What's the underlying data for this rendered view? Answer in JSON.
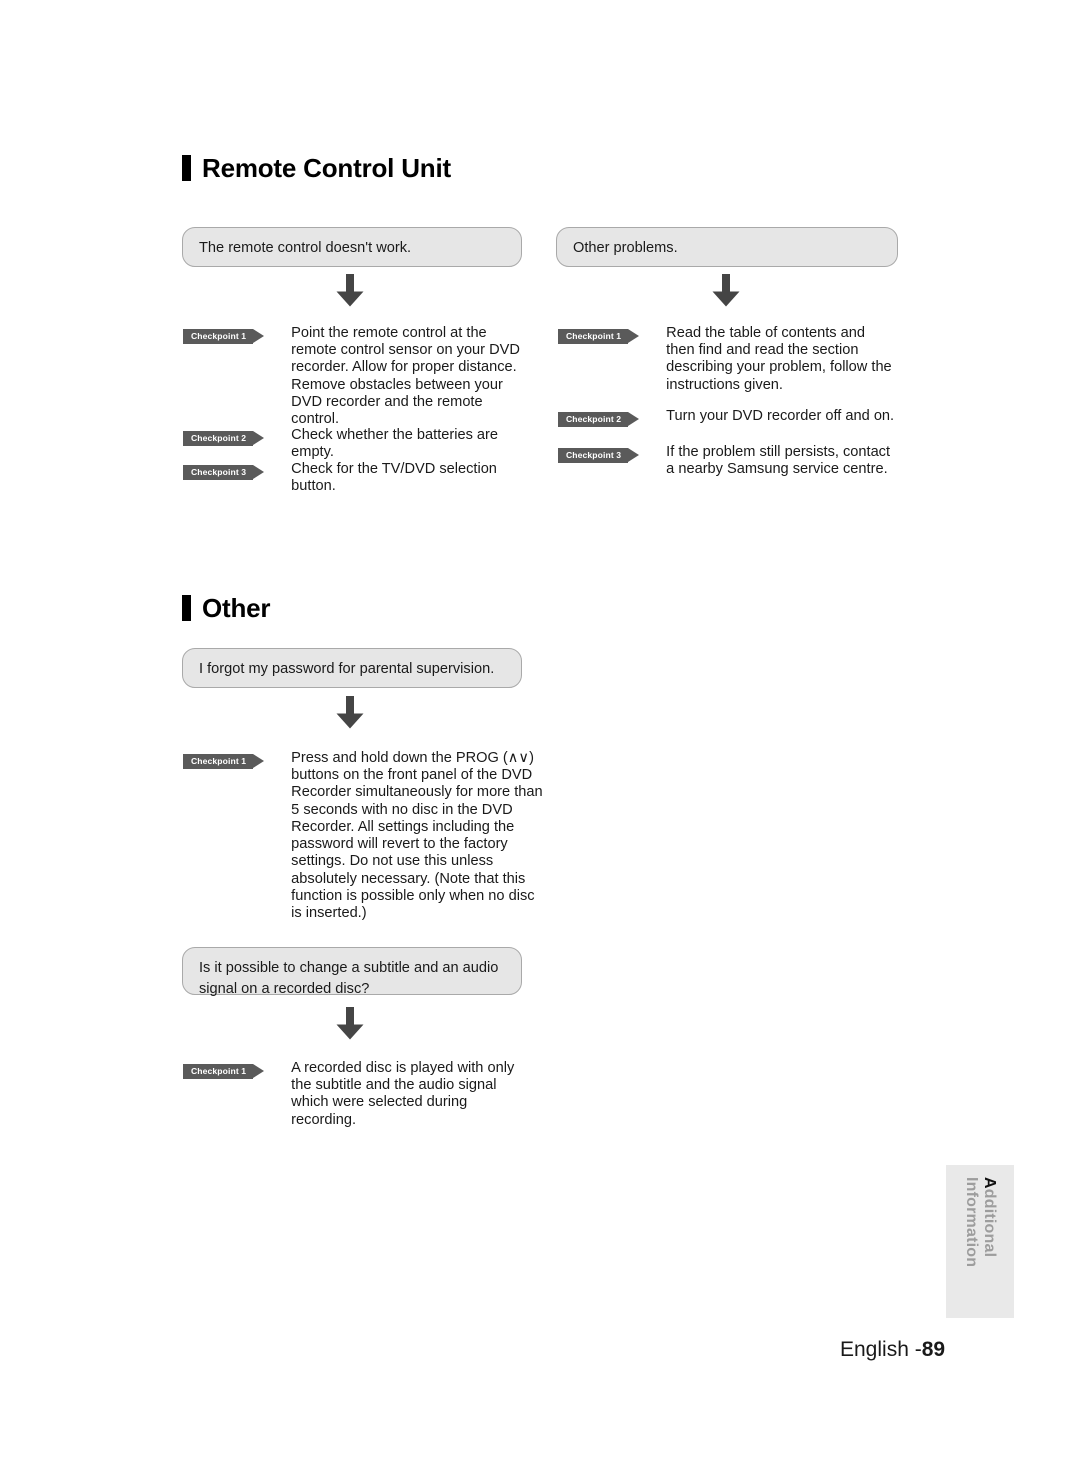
{
  "page": {
    "footer_label": "English -",
    "page_number": "89",
    "side_tab": {
      "lead": "A",
      "rest": "dditional Information",
      "full": "Additional Information"
    }
  },
  "icons": {
    "down_arrow": "down-arrow-icon",
    "heading_marker": "heading-bar-icon"
  },
  "colors": {
    "box_fill": "#e6e6e6",
    "box_border": "#a9a9a9",
    "badge_fill": "#5a5a5a",
    "arrow_fill": "#454545",
    "side_tab_fill": "#e9e9e9",
    "text": "#1a1a1a"
  },
  "sections": [
    {
      "title": "Remote Control Unit",
      "columns": [
        {
          "question": "The remote control doesn't work.",
          "checkpoints": [
            {
              "label": "Checkpoint 1",
              "text": "Point the remote control at the remote control sensor on your DVD recorder. Allow for proper distance. Remove obstacles between your DVD recorder and the remote control."
            },
            {
              "label": "Checkpoint 2",
              "text": "Check whether the batteries are empty."
            },
            {
              "label": "Checkpoint 3",
              "text": "Check for the TV/DVD selection button."
            }
          ]
        },
        {
          "question": "Other problems.",
          "checkpoints": [
            {
              "label": "Checkpoint 1",
              "text": "Read the table of contents and then find and read the section describing your problem, follow the instructions given."
            },
            {
              "label": "Checkpoint 2",
              "text": "Turn your DVD recorder off and on."
            },
            {
              "label": "Checkpoint 3",
              "text": "If the problem still persists, contact a nearby Samsung service centre."
            }
          ]
        }
      ]
    },
    {
      "title": "Other",
      "columns": [
        {
          "question": "I forgot my password for parental supervision.",
          "checkpoints": [
            {
              "label": "Checkpoint 1",
              "text": "Press and hold down the PROG (∧∨) buttons on the front panel of the DVD Recorder simultaneously for more than 5 seconds with no disc in the DVD Recorder. All settings including the password will revert to the factory settings. Do not use this unless absolutely necessary. (Note that this function is possible only when no disc is inserted.)"
            }
          ]
        },
        {
          "question": "Is it possible to change a subtitle and an audio signal on a recorded disc?",
          "checkpoints": [
            {
              "label": "Checkpoint 1",
              "text": "A recorded disc is played with only the subtitle and the audio signal which were selected during recording."
            }
          ]
        }
      ]
    }
  ]
}
